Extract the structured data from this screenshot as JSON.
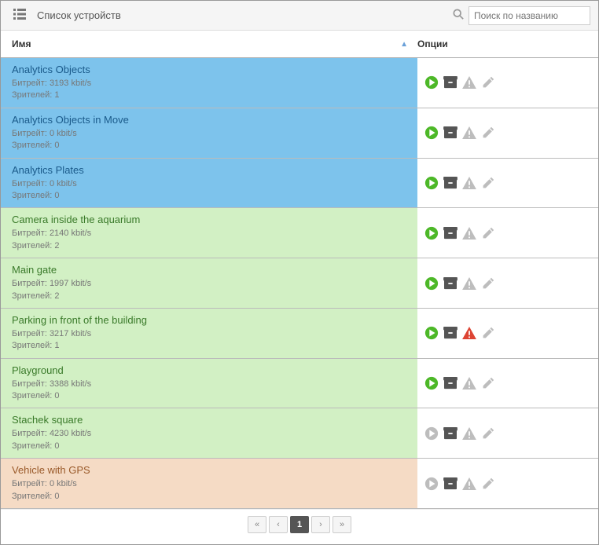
{
  "toolbar": {
    "title": "Список устройств",
    "search_placeholder": "Поиск по названию"
  },
  "headers": {
    "name": "Имя",
    "options": "Опции"
  },
  "labels": {
    "bitrate_prefix": "Битрейт: ",
    "viewers_prefix": "Зрителей: ",
    "bitrate_unit": " kbit/s"
  },
  "devices": [
    {
      "name": "Analytics Objects",
      "bitrate": "3193",
      "viewers": "1",
      "row_class": "bg-blue",
      "play": "green",
      "warn": "grey"
    },
    {
      "name": "Analytics Objects in Move",
      "bitrate": "0",
      "viewers": "0",
      "row_class": "bg-blue",
      "play": "green",
      "warn": "grey"
    },
    {
      "name": "Analytics Plates",
      "bitrate": "0",
      "viewers": "0",
      "row_class": "bg-blue",
      "play": "green",
      "warn": "grey"
    },
    {
      "name": "Camera inside the aquarium",
      "bitrate": "2140",
      "viewers": "2",
      "row_class": "bg-green",
      "play": "green",
      "warn": "grey"
    },
    {
      "name": "Main gate",
      "bitrate": "1997",
      "viewers": "2",
      "row_class": "bg-green",
      "play": "green",
      "warn": "grey"
    },
    {
      "name": "Parking in front of the building",
      "bitrate": "3217",
      "viewers": "1",
      "row_class": "bg-green",
      "play": "green",
      "warn": "red"
    },
    {
      "name": "Playground",
      "bitrate": "3388",
      "viewers": "0",
      "row_class": "bg-green",
      "play": "green",
      "warn": "grey"
    },
    {
      "name": "Stachek square",
      "bitrate": "4230",
      "viewers": "0",
      "row_class": "bg-green",
      "play": "grey",
      "warn": "grey"
    },
    {
      "name": "Vehicle with GPS",
      "bitrate": "0",
      "viewers": "0",
      "row_class": "bg-orange",
      "play": "grey",
      "warn": "grey"
    }
  ],
  "pager": {
    "first": "«",
    "prev": "‹",
    "current": "1",
    "next": "›",
    "last": "»"
  }
}
